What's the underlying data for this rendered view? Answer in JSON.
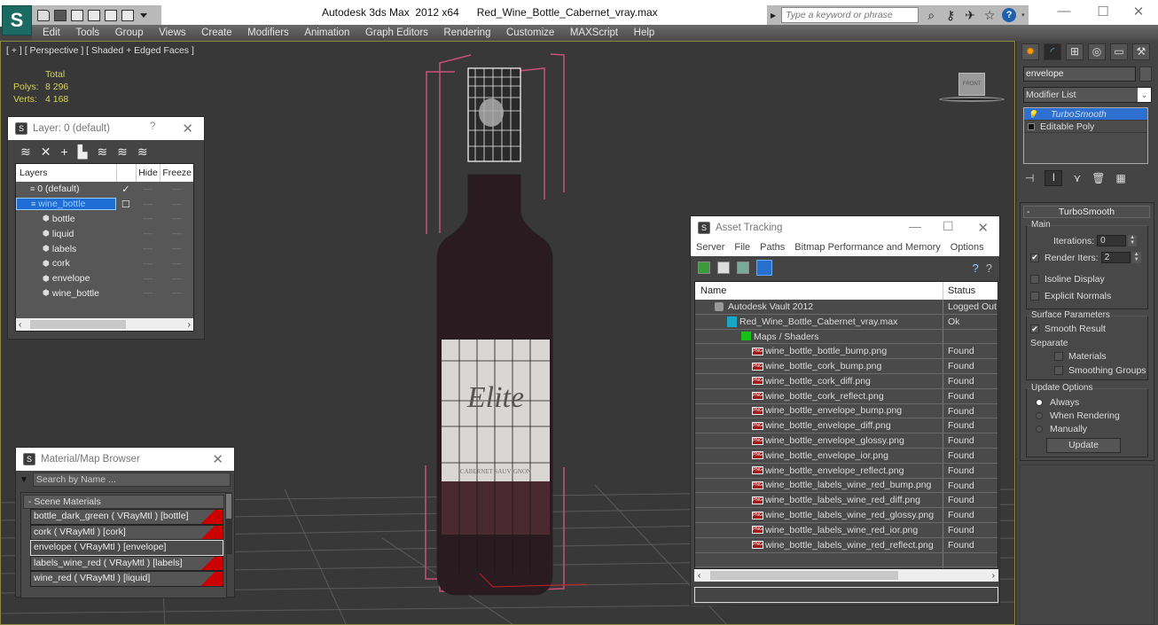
{
  "app": {
    "title": "Autodesk 3ds Max  2012 x64",
    "filename": "Red_Wine_Bottle_Cabernet_vray.max",
    "logo_icon": "app-logo-icon"
  },
  "quick_access": {
    "icons": [
      "open-folder-icon",
      "save-icon",
      "new-scene-icon",
      "project-folder-icon",
      "undo-icon",
      "redo-icon",
      "dropdown-arrow-icon"
    ]
  },
  "infocenter": {
    "search_placeholder": "Type a keyword or phrase",
    "icons": [
      "binoculars-icon",
      "key-icon",
      "satellite-icon",
      "star-icon",
      "help-icon"
    ]
  },
  "window_controls": {
    "minimize": "—",
    "maximize": "☐",
    "close": "✕"
  },
  "menu": [
    "Edit",
    "Tools",
    "Group",
    "Views",
    "Create",
    "Modifiers",
    "Animation",
    "Graph Editors",
    "Rendering",
    "Customize",
    "MAXScript",
    "Help"
  ],
  "viewport": {
    "label": "[ + ] [ Perspective ] [ Shaded + Edged Faces ]",
    "stats": {
      "header": "Total",
      "polys_label": "Polys:",
      "polys": "8 296",
      "verts_label": "Verts:",
      "verts": "4 168"
    },
    "viewcube_label": "FRONT",
    "bottle_label_script": "Elite",
    "bottle_label_sub": "CABERNET SAUVIGNON"
  },
  "layer_dialog": {
    "title": "Layer: 0 (default)",
    "help": "?",
    "close": "✕",
    "tools": [
      "new-layer-icon",
      "delete-icon",
      "add-icon",
      "select-objects-icon",
      "select-layer-icon",
      "highlight-icon",
      "hide-all-icon"
    ],
    "columns": [
      "Layers",
      "",
      "Hide",
      "Freeze"
    ],
    "rows": [
      {
        "name": "0 (default)",
        "type": "layer",
        "active": "✓",
        "hide": "----",
        "freeze": "----",
        "selected": false
      },
      {
        "name": "wine_bottle",
        "type": "layer",
        "active": "☐",
        "hide": "----",
        "freeze": "----",
        "selected": true
      },
      {
        "name": "bottle",
        "type": "object",
        "active": "",
        "hide": "----",
        "freeze": "----",
        "selected": false
      },
      {
        "name": "liquid",
        "type": "object",
        "active": "",
        "hide": "----",
        "freeze": "----",
        "selected": false
      },
      {
        "name": "labels",
        "type": "object",
        "active": "",
        "hide": "----",
        "freeze": "----",
        "selected": false
      },
      {
        "name": "cork",
        "type": "object",
        "active": "",
        "hide": "----",
        "freeze": "----",
        "selected": false
      },
      {
        "name": "envelope",
        "type": "object",
        "active": "",
        "hide": "----",
        "freeze": "----",
        "selected": false
      },
      {
        "name": "wine_bottle",
        "type": "object",
        "active": "",
        "hide": "----",
        "freeze": "----",
        "selected": false
      }
    ]
  },
  "material_browser": {
    "title": "Material/Map Browser",
    "close": "✕",
    "search_placeholder": "Search by Name ...",
    "category": "- Scene Materials",
    "items": [
      {
        "label": "bottle_dark_green  ( VRayMtl )  [bottle]",
        "swatch": "#cc0000",
        "selected": false
      },
      {
        "label": "cork  ( VRayMtl )  [cork]",
        "swatch": "#cc0000",
        "selected": false
      },
      {
        "label": "envelope  ( VRayMtl )  [envelope]",
        "swatch": "",
        "selected": true
      },
      {
        "label": "labels_wine_red  ( VRayMtl )  [labels]",
        "swatch": "#cc0000",
        "selected": false
      },
      {
        "label": "wine_red  ( VRayMtl )  [liquid]",
        "swatch": "#cc0000",
        "selected": false
      }
    ]
  },
  "asset_tracking": {
    "title": "Asset Tracking",
    "controls": {
      "minimize": "—",
      "maximize": "☐",
      "close": "✕"
    },
    "menu": [
      "Server",
      "File",
      "Paths",
      "Bitmap Performance and Memory",
      "Options"
    ],
    "tools": [
      "refresh-icon",
      "list-view-icon",
      "thumbnail-view-icon",
      "table-view-icon"
    ],
    "columns": {
      "name": "Name",
      "status": "Status"
    },
    "rows": [
      {
        "name": "Autodesk Vault 2012",
        "status": "Logged Out",
        "indent": 1,
        "icon": "vault"
      },
      {
        "name": "Red_Wine_Bottle_Cabernet_vray.max",
        "status": "Ok",
        "indent": 2,
        "icon": "max"
      },
      {
        "name": "Maps / Shaders",
        "status": "",
        "indent": 3,
        "icon": "maps"
      },
      {
        "name": "wine_bottle_bottle_bump.png",
        "status": "Found",
        "indent": 4,
        "icon": "png"
      },
      {
        "name": "wine_bottle_cork_bump.png",
        "status": "Found",
        "indent": 4,
        "icon": "png"
      },
      {
        "name": "wine_bottle_cork_diff.png",
        "status": "Found",
        "indent": 4,
        "icon": "png"
      },
      {
        "name": "wine_bottle_cork_reflect.png",
        "status": "Found",
        "indent": 4,
        "icon": "png"
      },
      {
        "name": "wine_bottle_envelope_bump.png",
        "status": "Found",
        "indent": 4,
        "icon": "png"
      },
      {
        "name": "wine_bottle_envelope_diff.png",
        "status": "Found",
        "indent": 4,
        "icon": "png"
      },
      {
        "name": "wine_bottle_envelope_glossy.png",
        "status": "Found",
        "indent": 4,
        "icon": "png"
      },
      {
        "name": "wine_bottle_envelope_ior.png",
        "status": "Found",
        "indent": 4,
        "icon": "png"
      },
      {
        "name": "wine_bottle_envelope_reflect.png",
        "status": "Found",
        "indent": 4,
        "icon": "png"
      },
      {
        "name": "wine_bottle_labels_wine_red_bump.png",
        "status": "Found",
        "indent": 4,
        "icon": "png"
      },
      {
        "name": "wine_bottle_labels_wine_red_diff.png",
        "status": "Found",
        "indent": 4,
        "icon": "png"
      },
      {
        "name": "wine_bottle_labels_wine_red_glossy.png",
        "status": "Found",
        "indent": 4,
        "icon": "png"
      },
      {
        "name": "wine_bottle_labels_wine_red_ior.png",
        "status": "Found",
        "indent": 4,
        "icon": "png"
      },
      {
        "name": "wine_bottle_labels_wine_red_reflect.png",
        "status": "Found",
        "indent": 4,
        "icon": "png"
      }
    ]
  },
  "command_panel": {
    "tabs": [
      "create-icon",
      "modify-icon",
      "hierarchy-icon",
      "motion-icon",
      "display-icon",
      "utilities-icon"
    ],
    "object_name": "envelope",
    "modifier_list": "Modifier List",
    "stack": [
      {
        "label": "TurboSmooth",
        "selected": true
      },
      {
        "label": "Editable Poly",
        "selected": false
      }
    ],
    "turbosmooth": {
      "title": "TurboSmooth",
      "main_group": "Main",
      "iterations_label": "Iterations:",
      "iterations": "0",
      "render_iters_label": "Render Iters:",
      "render_iters": "2",
      "render_iters_checked": true,
      "isoline_display": "Isoline Display",
      "explicit_normals": "Explicit Normals",
      "surface_group": "Surface Parameters",
      "smooth_result": "Smooth Result",
      "smooth_result_checked": true,
      "separate_label": "Separate",
      "materials": "Materials",
      "smoothing_groups": "Smoothing Groups",
      "update_group": "Update Options",
      "update_options": [
        "Always",
        "When Rendering",
        "Manually"
      ],
      "update_selected": "Always",
      "update_button": "Update"
    }
  }
}
